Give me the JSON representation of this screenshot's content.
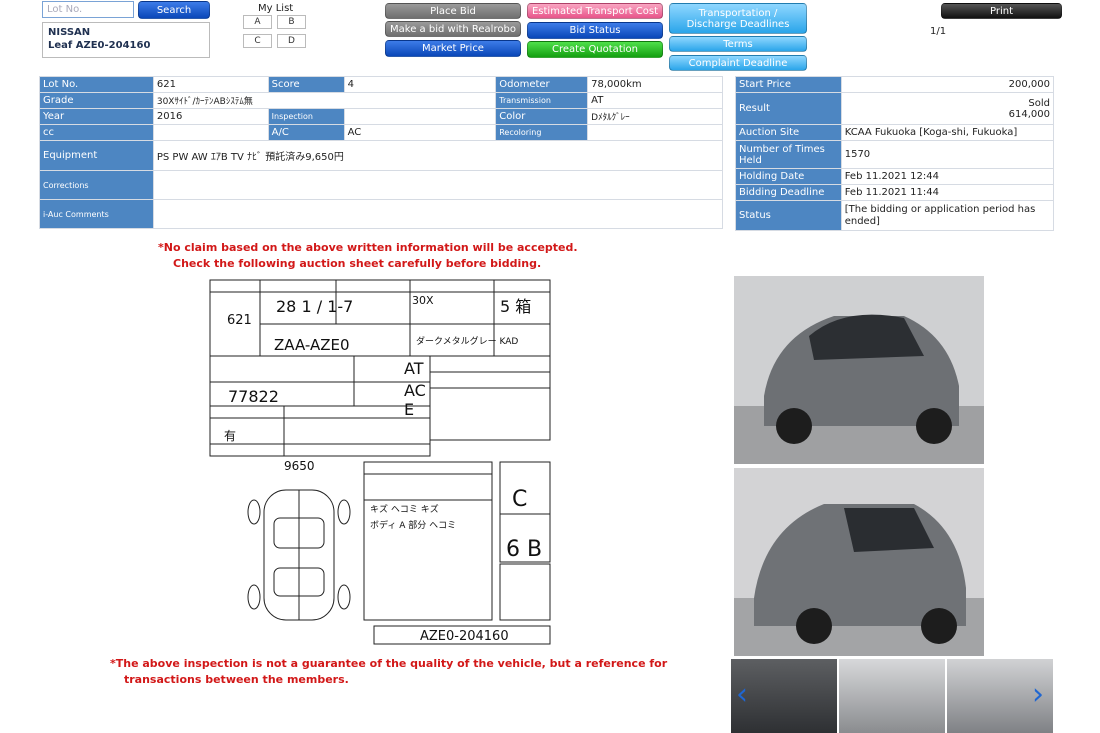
{
  "search": {
    "placeholder": "Lot No.",
    "button": "Search"
  },
  "car": {
    "make": "NISSAN",
    "model_line": "Leaf AZE0-204160"
  },
  "mylist": {
    "title": "My List",
    "buttons": [
      "A",
      "B",
      "C",
      "D"
    ]
  },
  "actions": {
    "place_bid": "Place Bid",
    "realrobo": "Make a bid with Realrobo",
    "market_price": "Market Price",
    "transport_cost": "Estimated Transport Cost",
    "bid_status": "Bid Status",
    "create_quotation": "Create Quotation",
    "transportation": "Transportation / Discharge Deadlines",
    "terms": "Terms",
    "complaint": "Complaint Deadline",
    "print": "Print"
  },
  "pagination": "1/1",
  "details": {
    "lot_no_label": "Lot No.",
    "lot_no": "621",
    "score_label": "Score",
    "score": "4",
    "odometer_label": "Odometer",
    "odometer": "78,000km",
    "grade_label": "Grade",
    "grade": "30Xｻｲﾄﾞ/ｶｰﾃﾝABｼｽﾃﾑ無",
    "transmission_label": "Transmission",
    "transmission": "AT",
    "year_label": "Year",
    "year": "2016",
    "inspection_label": "Inspection",
    "inspection": "",
    "color_label": "Color",
    "color": "Dﾒﾀﾙｸﾞﾚｰ",
    "cc_label": "cc",
    "cc": "",
    "ac_label": "A/C",
    "ac": "AC",
    "recoloring_label": "Recoloring",
    "recoloring": "",
    "equipment_label": "Equipment",
    "equipment": "PS PW AW ｴｱB TV ﾅﾋﾞ 預託済み9,650円",
    "corrections_label": "Corrections",
    "corrections": "",
    "iauc_label": "i-Auc Comments",
    "iauc": ""
  },
  "auction": {
    "start_price_label": "Start Price",
    "start_price": "200,000",
    "result_label": "Result",
    "result_status": "Sold",
    "result_price": "614,000",
    "site_label": "Auction Site",
    "site": "KCAA Fukuoka [Koga-shi, Fukuoka]",
    "times_label": "Number of Times Held",
    "times": "1570",
    "holding_label": "Holding Date",
    "holding": "Feb 11.2021 12:44",
    "deadline_label": "Bidding Deadline",
    "deadline": "Feb 11.2021 11:44",
    "status_label": "Status",
    "status": "[The bidding or application period has ended]"
  },
  "notes": {
    "top_line1": "*No claim based on the above written information will be accepted.",
    "top_line2": "Check the following auction sheet carefully before bidding.",
    "bottom_line1": "*The above inspection is not a guarantee of the quality of the vehicle, but a reference for",
    "bottom_line2": "transactions between the members."
  },
  "sheet": {
    "lot": "621",
    "year_written": "28 1 / 1-7",
    "grade_written": "30X",
    "score_written": "5 箱",
    "model_code": "ZAA-AZE0",
    "color_written": "ダークメタルグレー KAD",
    "shift": "AT",
    "ac": "AC",
    "fuel": "E",
    "mileage": "77822",
    "repair": "有",
    "recycle": "9650",
    "comment1": "キズ ヘコミ キズ",
    "comment2": "ボディ A 部分 ヘコミ",
    "eval_exterior": "C",
    "eval_interior": "6 B",
    "chassis": "AZE0-204160"
  },
  "colors": {
    "header_blue": "#4d86c2",
    "warning_red": "#d21818"
  },
  "icons": {
    "prev": "chevron-left-icon",
    "next": "chevron-right-icon"
  }
}
